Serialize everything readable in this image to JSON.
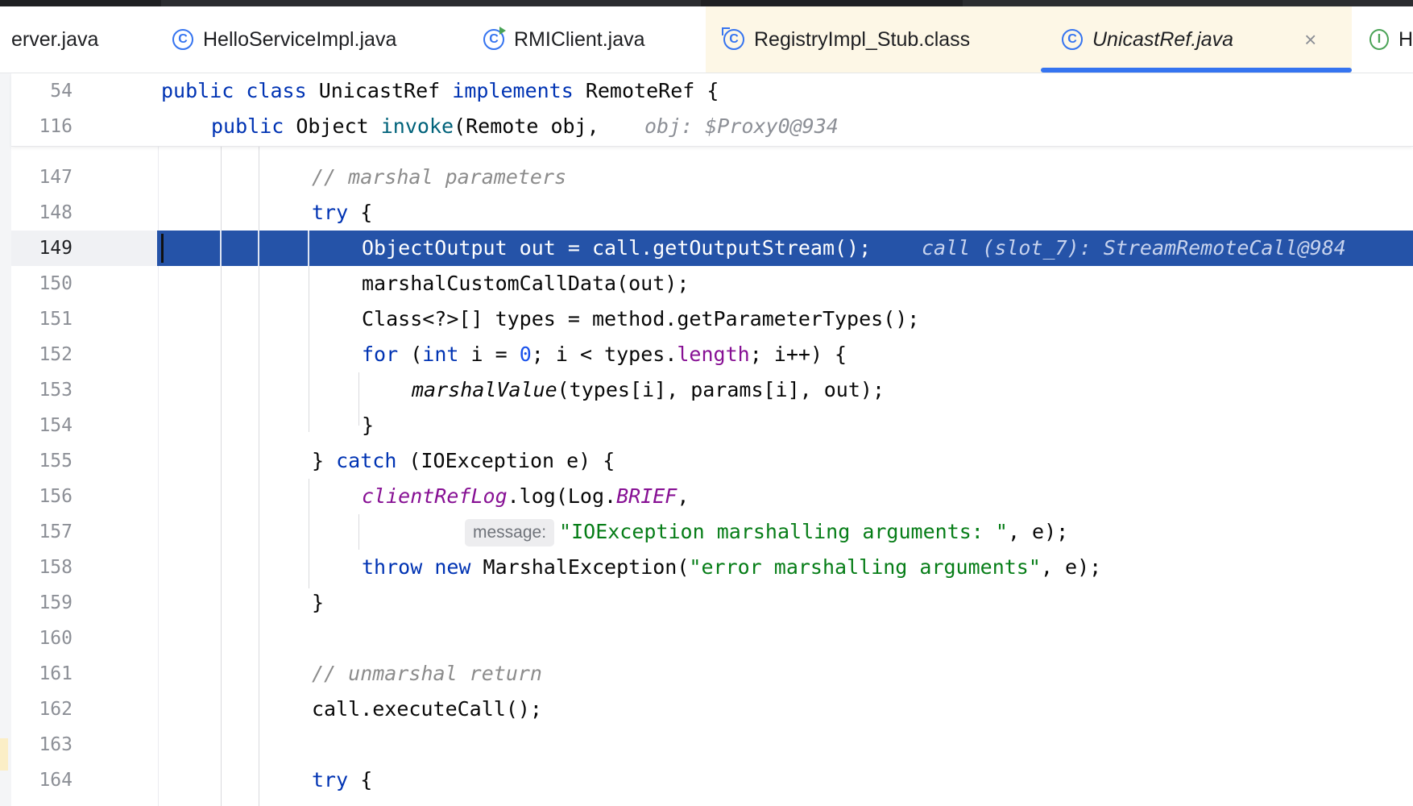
{
  "tabs": [
    {
      "label": "erver.java",
      "icon": "none"
    },
    {
      "label": "HelloServiceImpl.java",
      "icon": "class-icon"
    },
    {
      "label": "RMIClient.java",
      "icon": "runnable-class-icon"
    },
    {
      "label": "RegistryImpl_Stub.class",
      "icon": "compiled-class-icon"
    },
    {
      "label": "UnicastRef.java",
      "icon": "class-icon",
      "active": true
    },
    {
      "label": "H",
      "icon": "interface-icon"
    }
  ],
  "tab_icons": {
    "class": "C",
    "interface": "I"
  },
  "close_glyph": "×",
  "accent_color": "#3574f0",
  "selection_color": "#2553a8",
  "sticky": {
    "l1": {
      "num": "54",
      "t1": "public",
      "t2": " ",
      "t3": "class",
      "t4": " UnicastRef ",
      "t5": "implements",
      "t6": " RemoteRef {"
    },
    "l2": {
      "num": "116",
      "t1": "public",
      "t2": " Object ",
      "t3": "invoke",
      "t4": "(Remote obj,",
      "hint": "obj: $Proxy0@934"
    }
  },
  "lines": {
    "l147": {
      "num": "147",
      "comment": "// marshal parameters"
    },
    "l148": {
      "num": "148",
      "kw": "try",
      "rest": " {"
    },
    "l149": {
      "num": "149",
      "code": "ObjectOutput out = call.getOutputStream();",
      "hint": "call (slot_7): StreamRemoteCall@984"
    },
    "l150": {
      "num": "150",
      "code": "marshalCustomCallData(out);"
    },
    "l151": {
      "num": "151",
      "code": "Class<?>[] types = method.getParameterTypes();"
    },
    "l152": {
      "num": "152",
      "kw1": "for",
      "a": " (",
      "kw2": "int",
      "b": " i = ",
      "num0": "0",
      "c": "; i < types.",
      "fld": "length",
      "d": "; i++) {"
    },
    "l153": {
      "num": "153",
      "fn": "marshalValue",
      "rest": "(types[i], params[i], out);"
    },
    "l154": {
      "num": "154",
      "code": "}"
    },
    "l155": {
      "num": "155",
      "a": "} ",
      "kw": "catch",
      "b": " (IOException e) {"
    },
    "l156": {
      "num": "156",
      "ifld": "clientRefLog",
      "a": ".log(Log.",
      "ifld2": "BRIEF",
      "b": ","
    },
    "l157": {
      "num": "157",
      "param": "message:",
      "str": "\"IOException marshalling arguments: \"",
      "rest": ", e);"
    },
    "l158": {
      "num": "158",
      "kw1": "throw",
      "sp": " ",
      "kw2": "new",
      "a": " MarshalException(",
      "str": "\"error marshalling arguments\"",
      "b": ", e);"
    },
    "l159": {
      "num": "159",
      "code": "}"
    },
    "l160": {
      "num": "160"
    },
    "l161": {
      "num": "161",
      "comment": "// unmarshal return"
    },
    "l162": {
      "num": "162",
      "code": "call.executeCall();"
    },
    "l163": {
      "num": "163"
    },
    "l164": {
      "num": "164",
      "kw": "try",
      "rest": " {"
    }
  }
}
